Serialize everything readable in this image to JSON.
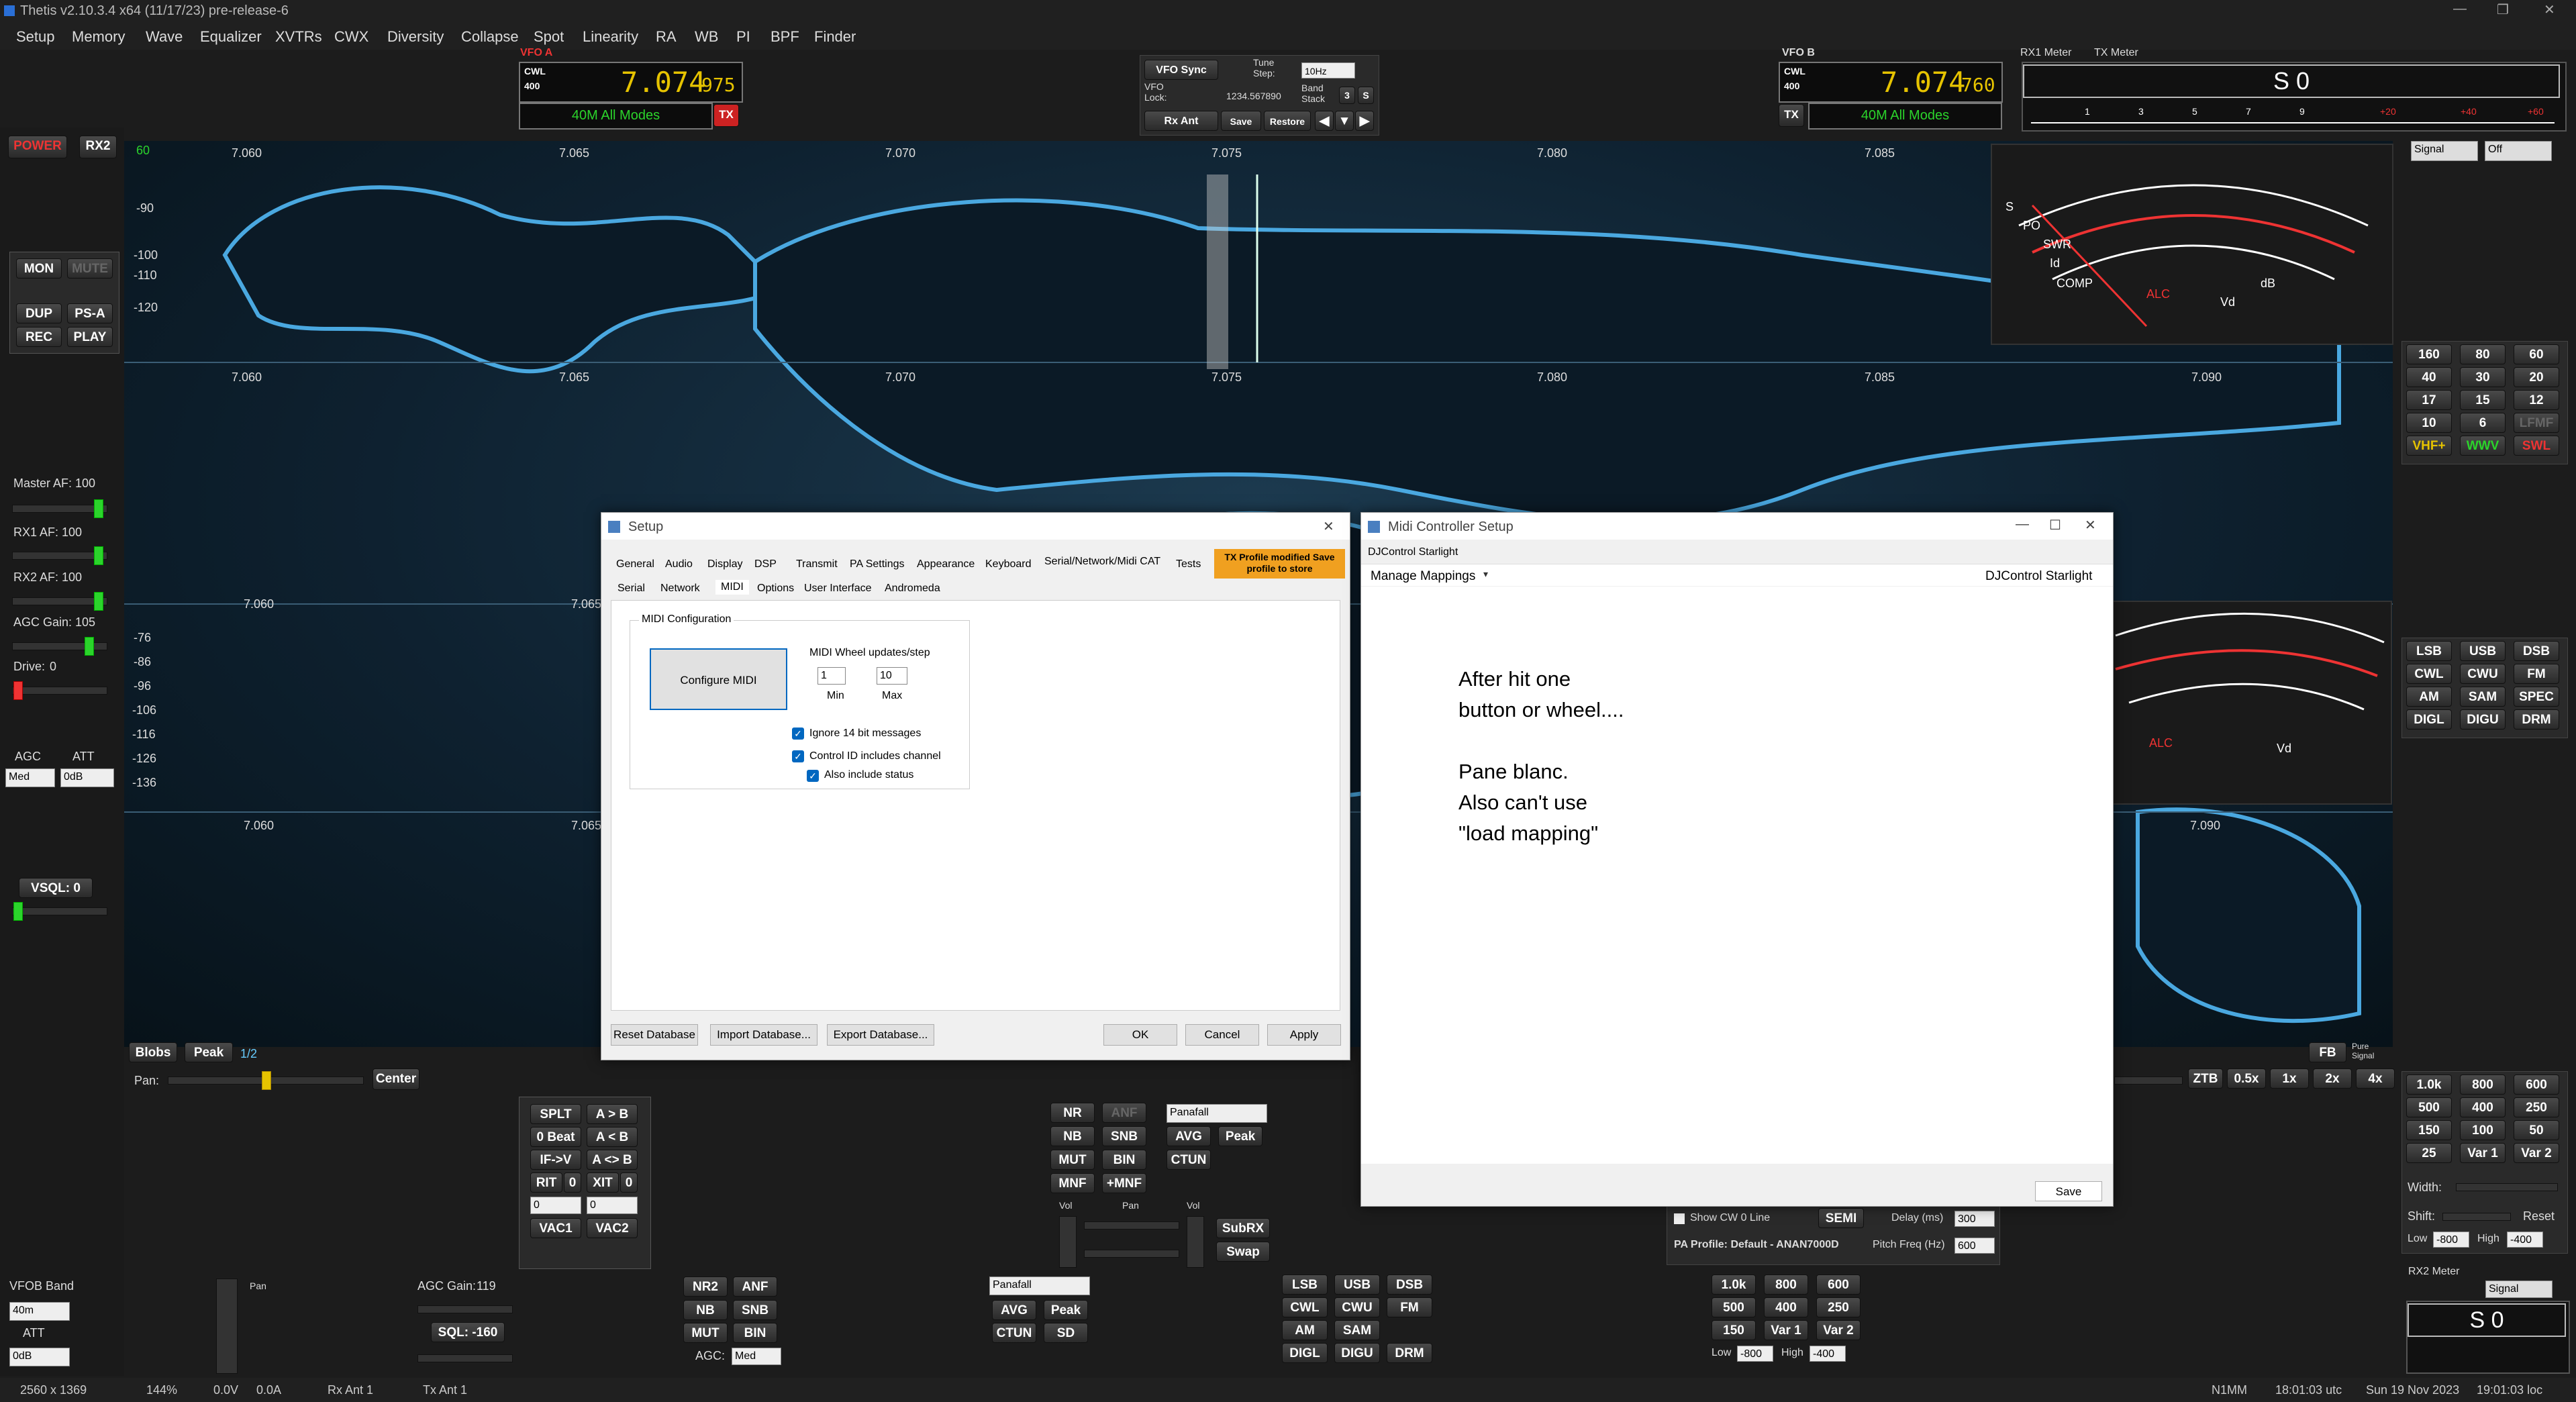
{
  "app": {
    "title": "Thetis v2.10.3.4 x64 (11/17/23) pre-release-6",
    "win_min": "—",
    "win_max": "❐",
    "win_close": "✕"
  },
  "menu": [
    "Setup",
    "Memory",
    "Wave",
    "Equalizer",
    "XVTRs",
    "CWX",
    "Diversity",
    "Collapse",
    "Spot",
    "Linearity",
    "RA",
    "WB",
    "PI",
    "BPF",
    "Finder"
  ],
  "vfoa": {
    "label": "VFO A",
    "mode": "CWL",
    "sub": "400",
    "freq": "7.074",
    "freq_small": "975",
    "band": "40M All Modes",
    "tx": "TX"
  },
  "vfob": {
    "label": "VFO B",
    "mode": "CWL",
    "sub": "400",
    "freq": "7.074",
    "freq_small": "760",
    "band": "40M All Modes",
    "tx": "TX"
  },
  "center_ctrl": {
    "vfo_sync": "VFO Sync",
    "tune_step": "Tune Step:",
    "step_value": "10Hz",
    "vfo_lock": "VFO Lock:",
    "freq": "1234.567890",
    "band_stack": "Band Stack",
    "stack_val": "3",
    "stack_s": "S",
    "rx_ant": "Rx Ant",
    "save": "Save",
    "restore": "Restore"
  },
  "meters": {
    "rx1": "RX1 Meter",
    "tx": "TX Meter",
    "s_value": "S 0",
    "signal": "Signal",
    "off": "Off",
    "rx2meter": "RX2 Meter",
    "rx2_s": "S 0",
    "scale": [
      "1",
      "3",
      "5",
      "7",
      "9",
      "+20",
      "+40",
      "+60"
    ]
  },
  "left": {
    "power": "POWER",
    "rx2": "RX2",
    "mon": "MON",
    "mute": "MUTE",
    "dup": "DUP",
    "psa": "PS-A",
    "rec": "REC",
    "play": "PLAY",
    "master": "Master AF:",
    "master_v": "100",
    "rx1af": "RX1 AF:",
    "rx1af_v": "100",
    "rx2af": "RX2 AF:",
    "rx2af_v": "100",
    "agc_gain": "AGC Gain:",
    "agc_gain_v": "105",
    "drive": "Drive:",
    "drive_v": "0",
    "agc": "AGC",
    "att": "ATT",
    "agc_sel": "Med",
    "att_sel": "0dB",
    "vsql": "VSQL: 0"
  },
  "panadapter": {
    "freqs_top": [
      "7.060",
      "7.065",
      "7.070",
      "7.075",
      "7.080",
      "7.085"
    ],
    "freqs_mid": [
      "7.060",
      "7.065",
      "7.070",
      "7.075",
      "7.080",
      "7.085",
      "7.090"
    ],
    "freqs_low": [
      "7.060",
      "7.065"
    ],
    "freqs_bot": [
      "7.060",
      "7.065",
      "7.090"
    ],
    "db_top": [
      "60",
      "-90",
      "-100",
      "-110",
      "-120"
    ],
    "db_low": [
      "-76",
      "-86",
      "-96",
      "-106",
      "-116",
      "-126",
      "-136"
    ],
    "blobs": "Blobs",
    "peak": "Peak",
    "page": "1/2",
    "pan": "Pan:",
    "center": "Center",
    "fb": "FB",
    "pure": "Pure Signal",
    "ztb": "ZTB",
    "z05": "0.5x",
    "z1": "1x",
    "z2": "2x",
    "z4": "4x"
  },
  "analog": {
    "s": "S",
    "po": "PO",
    "swr": "SWR",
    "id": "Id",
    "comp": "COMP",
    "alc": "ALC",
    "db": "dB",
    "vd": "Vd"
  },
  "bands": [
    "160",
    "80",
    "60",
    "40",
    "30",
    "20",
    "17",
    "15",
    "12",
    "10",
    "6",
    "LFMF",
    "VHF+",
    "WWV",
    "SWL"
  ],
  "modes": [
    "LSB",
    "USB",
    "DSB",
    "CWL",
    "CWU",
    "FM",
    "AM",
    "SAM",
    "SPEC",
    "DIGL",
    "DIGU",
    "DRM"
  ],
  "filters": [
    "1.0k",
    "800",
    "600",
    "500",
    "400",
    "250",
    "150",
    "100",
    "50",
    "25",
    "Var 1",
    "Var 2"
  ],
  "filter_ctrl": {
    "width": "Width:",
    "shift": "Shift:",
    "reset": "Reset",
    "low": "Low",
    "high": "High",
    "low_v": "-800",
    "high_v": "-400"
  },
  "bottom": {
    "splt": "SPLT",
    "atob": "A > B",
    "zbeat": "0 Beat",
    "btoa": "A < B",
    "ifv": "IF->V",
    "aswapb": "A <> B",
    "rit": "RIT",
    "rit_v": "0",
    "xit": "XIT",
    "xit_v": "0",
    "vac1": "VAC1",
    "vac2": "VAC2",
    "nr": "NR",
    "anf": "ANF",
    "nb": "NB",
    "snb": "SNB",
    "mut": "MUT",
    "bin": "BIN",
    "mnf": "MNF",
    "pmnf": "+MNF",
    "avg": "AVG",
    "peak": "Peak",
    "ctun": "CTUN",
    "panafall": "Panafall",
    "vol": "Vol",
    "pan": "Pan",
    "subrx": "SubRX",
    "swap": "Swap",
    "show_cw": "Show CW 0 Line",
    "semi": "SEMI",
    "delay": "Delay (ms)",
    "delay_v": "300",
    "pa_profile": "PA Profile: Default - ANAN7000D",
    "pitch": "Pitch Freq (Hz)",
    "pitch_v": "600"
  },
  "rx2": {
    "vfob_band": "VFOB Band",
    "band": "40m",
    "att": "ATT",
    "att_v": "0dB",
    "pan": "Pan",
    "agc_gain": "AGC Gain:",
    "agc_gain_v": "119",
    "sql": "SQL: -160",
    "nr2": "NR2",
    "anf": "ANF",
    "nb": "NB",
    "snb": "SNB",
    "mut": "MUT",
    "bin": "BIN",
    "agc": "AGC:",
    "agc_v": "Med",
    "panafall": "Panafall",
    "avg": "AVG",
    "peak": "Peak",
    "ctun": "CTUN",
    "sd": "SD",
    "modes": [
      "LSB",
      "USB",
      "DSB",
      "CWL",
      "CWU",
      "FM",
      "AM",
      "SAM",
      "DIGL",
      "DIGU",
      "DRM"
    ],
    "filters": [
      "1.0k",
      "800",
      "600",
      "500",
      "400",
      "250",
      "150",
      "Var 1",
      "Var 2"
    ],
    "low": "Low",
    "high": "High",
    "low_v": "-800",
    "high_v": "-400"
  },
  "setup": {
    "title": "Setup",
    "tabs1": [
      "General",
      "Audio",
      "Display",
      "DSP",
      "Transmit",
      "PA Settings",
      "Appearance",
      "Keyboard",
      "Serial/Network/Midi CAT",
      "Tests"
    ],
    "tabs2": [
      "Serial",
      "Network",
      "MIDI",
      "Options",
      "User Interface",
      "Andromeda"
    ],
    "tx_profile": "TX Profile modified Save profile to store",
    "midi_config": "MIDI Configuration",
    "configure": "Configure MIDI",
    "wheel": "MIDI Wheel updates/step",
    "min_v": "1",
    "max_v": "10",
    "min": "Min",
    "max": "Max",
    "ignore14": "Ignore 14 bit messages",
    "control_id": "Control ID includes channel",
    "also": "Also include status",
    "reset": "Reset Database",
    "import": "Import Database...",
    "export": "Export Database...",
    "ok": "OK",
    "cancel": "Cancel",
    "apply": "Apply"
  },
  "midi": {
    "title": "Midi Controller Setup",
    "tab": "DJControl Starlight",
    "manage": "Manage Mappings",
    "device": "DJControl Starlight",
    "note": [
      "After hit one",
      "button or wheel....",
      "",
      "Pane blanc.",
      "Also can't use",
      "\"load mapping\""
    ],
    "save": "Save"
  },
  "statusbar": {
    "res": "2560 x 1369",
    "zoom": "144%",
    "volt": "0.0V",
    "amp": "0.0A",
    "rxant": "Rx Ant 1",
    "txant": "Tx Ant 1",
    "call": "N1MM",
    "utc": "18:01:03 utc",
    "date": "Sun 19 Nov 2023",
    "loc": "19:01:03 loc"
  }
}
